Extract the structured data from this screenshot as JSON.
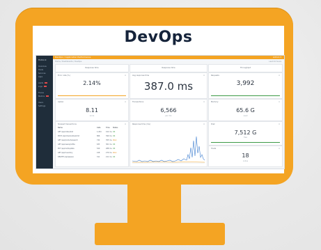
{
  "heading": "DevOps",
  "colors": {
    "frame": "#f4a423",
    "sidebar": "#1f2d3a",
    "green": "#3c9a46",
    "orange": "#f4a423",
    "blue": "#3f7fd0"
  },
  "dashboard": {
    "brand": "HoDock",
    "topbar": "DevOps / Application Performance",
    "topbar_right": "Admin ▾",
    "breadcrumb": "Home / Dashboards / DevOps",
    "breadcrumb_right": "Last 24 hours",
    "sidebar": [
      "Overview",
      "Hosts",
      "Services",
      "Apps",
      "Alerts",
      "Logs",
      "Traces",
      "Metrics",
      "Users",
      "Settings"
    ],
    "groups": [
      "Response time",
      "Response time",
      "Throughput"
    ],
    "tiles": {
      "a": {
        "label": "Error rate (%)",
        "value": "2.14%"
      },
      "b": {
        "label": "Avg response time",
        "value": "387.0 ms"
      },
      "c": {
        "label": "Requests",
        "value": "3,992"
      },
      "d": {
        "label": "Apdex",
        "value": "8.11",
        "sub": "score"
      },
      "e": {
        "label": "Transactions",
        "value": "6,566",
        "sub": "per min"
      },
      "f": {
        "label": "Memory",
        "value": "65.6 G",
        "sub": "used"
      },
      "g": {
        "label": "Disk",
        "value": "7,512 G",
        "sub": "free"
      },
      "h": {
        "label": "Hosts",
        "value": "18",
        "sub": "online"
      }
    },
    "table": {
      "title": "Slowest transactions",
      "headers": [
        "Name",
        "Calls",
        "Time",
        "Status"
      ],
      "rows": [
        [
          "GET /api/orders/list",
          "1,204",
          "412 ms",
          "OK"
        ],
        [
          "POST /api/checkout/submit",
          "866",
          "390 ms",
          "OK"
        ],
        [
          "GET /api/products/search",
          "742",
          "355 ms",
          "Warn"
        ],
        [
          "GET /api/users/profile",
          "633",
          "301 ms",
          "OK"
        ],
        [
          "PUT /api/cart/update",
          "520",
          "288 ms",
          "OK"
        ],
        [
          "GET /api/inventory",
          "418",
          "270 ms",
          "Warn"
        ],
        [
          "DELETE /api/session",
          "311",
          "211 ms",
          "OK"
        ]
      ]
    },
    "chart_label": "Response time (ms)"
  }
}
